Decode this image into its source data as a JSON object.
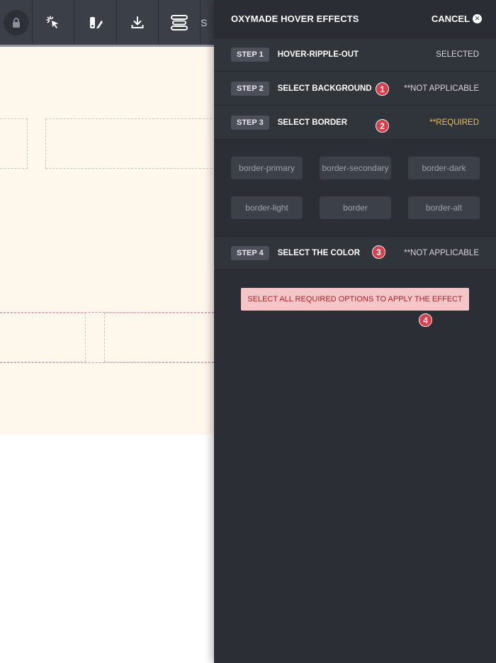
{
  "toolbar": {
    "icons": [
      "lock-icon",
      "cursor-click-icon",
      "paint-brush-icon",
      "download-icon",
      "stack-icon"
    ],
    "cut_label": "S"
  },
  "panel": {
    "title": "OXYMADE HOVER EFFECTS",
    "cancel_label": "CANCEL",
    "steps": [
      {
        "badge": "STEP 1",
        "name": "HOVER-RIPPLE-OUT",
        "status": "SELECTED"
      },
      {
        "badge": "STEP 2",
        "name": "SELECT BACKGROUND",
        "status": "**NOT APPLICABLE",
        "marker": "1"
      },
      {
        "badge": "STEP 3",
        "name": "SELECT BORDER",
        "status": "**REQUIRED",
        "marker": "2"
      },
      {
        "badge": "STEP 4",
        "name": "SELECT THE COLOR",
        "status": "**NOT APPLICABLE",
        "marker": "3"
      }
    ],
    "border_options": [
      "border-primary",
      "border-secondary",
      "border-dark",
      "border-light",
      "border",
      "border-alt"
    ],
    "apply_label": "SELECT ALL REQUIRED OPTIONS TO APPLY THE EFFECT",
    "apply_marker": "4"
  },
  "colors": {
    "panel_bg": "#2b2e35",
    "required": "#e9c24f",
    "marker": "#d93f4a",
    "apply_bg": "#f5c6c7",
    "apply_text": "#a8242e",
    "canvas_bg": "#fef7ec"
  }
}
